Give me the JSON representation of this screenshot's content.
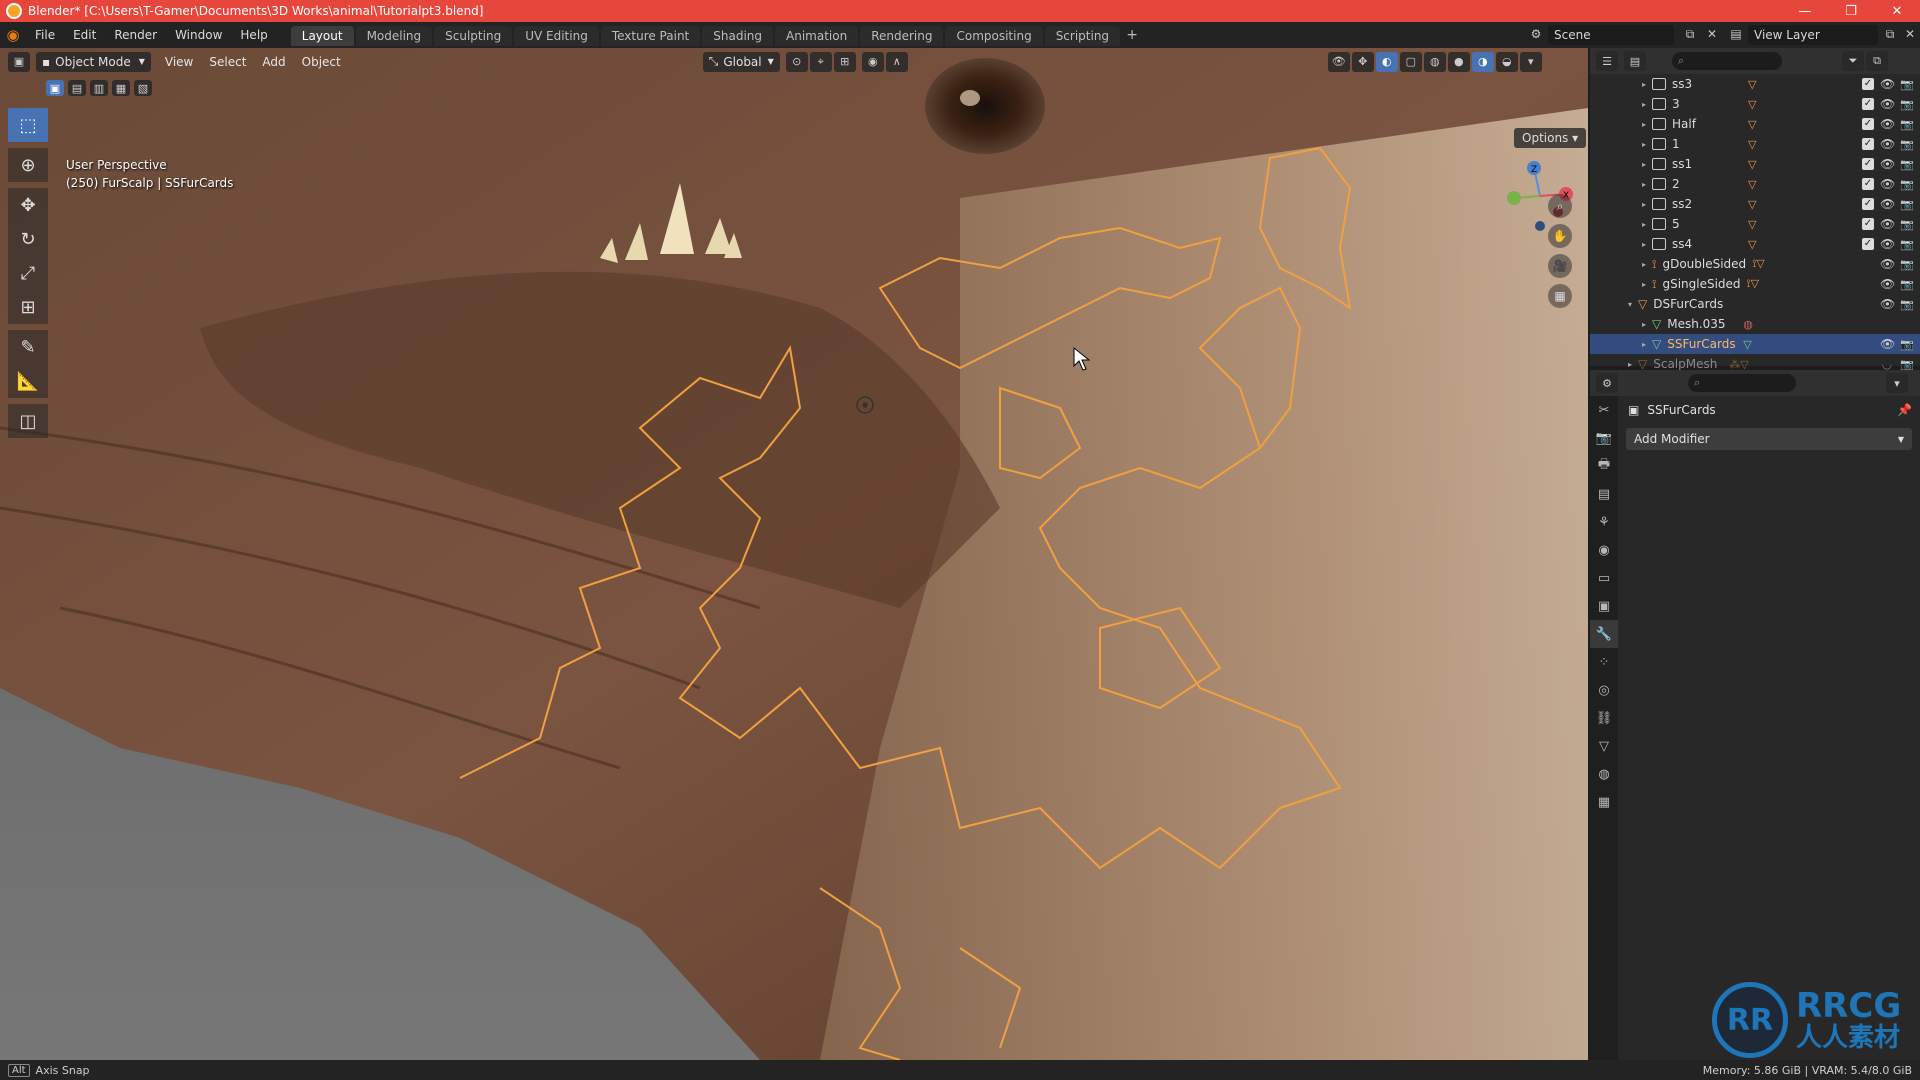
{
  "window": {
    "title": "Blender* [C:\\Users\\T-Gamer\\Documents\\3D Works\\animal\\Tutorialpt3.blend]",
    "minimize": "—",
    "maximize": "❐",
    "close": "✕"
  },
  "menubar": {
    "items": [
      "File",
      "Edit",
      "Render",
      "Window",
      "Help"
    ],
    "workspaces": [
      "Layout",
      "Modeling",
      "Sculpting",
      "UV Editing",
      "Texture Paint",
      "Shading",
      "Animation",
      "Rendering",
      "Compositing",
      "Scripting"
    ],
    "active_workspace": "Layout",
    "add_tab": "+",
    "scene": "Scene",
    "view_layer": "View Layer"
  },
  "viewport": {
    "mode": "Object Mode",
    "menus": [
      "View",
      "Select",
      "Add",
      "Object"
    ],
    "transform_orientation": "Global",
    "info_line1": "User Perspective",
    "info_line2": "(250) FurScalp | SSFurCards",
    "options_label": "Options",
    "gizmo_labels": {
      "z": "Z",
      "x": "X",
      "y": "Y"
    }
  },
  "outliner": {
    "rows": [
      {
        "name": "ss3",
        "type": "collection",
        "checked": true
      },
      {
        "name": "3",
        "type": "collection",
        "checked": true
      },
      {
        "name": "Half",
        "type": "collection",
        "checked": true
      },
      {
        "name": "1",
        "type": "collection",
        "checked": true
      },
      {
        "name": "ss1",
        "type": "collection",
        "checked": true
      },
      {
        "name": "2",
        "type": "collection",
        "checked": true
      },
      {
        "name": "ss2",
        "type": "collection",
        "checked": true
      },
      {
        "name": "5",
        "type": "collection",
        "checked": true
      },
      {
        "name": "ss4",
        "type": "collection",
        "checked": true
      },
      {
        "name": "gDoubleSided",
        "type": "object",
        "checked": false
      },
      {
        "name": "gSingleSided",
        "type": "object",
        "checked": false
      },
      {
        "name": "DSFurCards",
        "type": "object",
        "checked": false
      },
      {
        "name": "Mesh.035",
        "type": "mesh",
        "checked": false
      },
      {
        "name": "SSFurCards",
        "type": "mesh",
        "checked": false,
        "selected": true
      },
      {
        "name": "ScalpMesh",
        "type": "object",
        "checked": false,
        "dim": true
      }
    ]
  },
  "properties": {
    "object_name": "SSFurCards",
    "add_modifier": "Add Modifier"
  },
  "statusbar": {
    "key": "Alt",
    "hint": "Axis Snap",
    "memory": "Memory: 5.86 GiB | VRAM: 5.4/8.0 GiB"
  },
  "watermark": {
    "logo": "RR",
    "line1": "RRCG",
    "line2": "人人素材"
  },
  "colors": {
    "title_bar": "#e6463c",
    "accent_blue": "#4772b3",
    "selection_orange": "#f0a040"
  }
}
